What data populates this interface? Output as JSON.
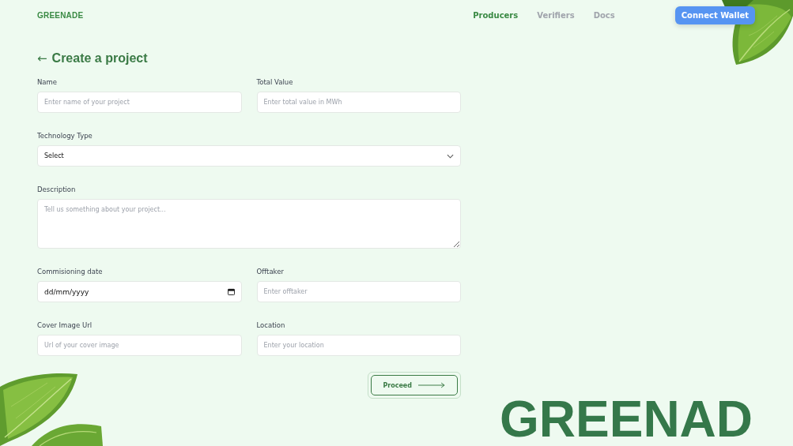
{
  "brand": "GREENADE",
  "nav": [
    {
      "label": "Producers",
      "selected": true
    },
    {
      "label": "Verifiers",
      "selected": false
    },
    {
      "label": "Docs",
      "selected": false
    }
  ],
  "connect_button": "Connect Wallet",
  "back_arrow": "←",
  "title": "Create a project",
  "fields": [
    {
      "kind": "input",
      "label": "Name",
      "placeholder": "Enter name of your project"
    },
    {
      "kind": "input",
      "label": "Total Value",
      "placeholder": "Enter total value in MWh"
    },
    {
      "kind": "select",
      "label": "Technology Type",
      "value": "Select"
    },
    {
      "kind": "textarea",
      "label": "Description",
      "placeholder": "Tell us something about your project..."
    },
    {
      "kind": "date",
      "label": "Commisioning date",
      "value": "dd/mm/yyyy"
    },
    {
      "kind": "input",
      "label": "Offtaker",
      "placeholder": "Enter offtaker"
    },
    {
      "kind": "input",
      "label": "Cover Image Url",
      "placeholder": "Url of your cover image"
    },
    {
      "kind": "input",
      "label": "Location",
      "placeholder": "Enter your location"
    }
  ],
  "proceed_button": "Proceed",
  "big_wordmark": "GREENAD"
}
